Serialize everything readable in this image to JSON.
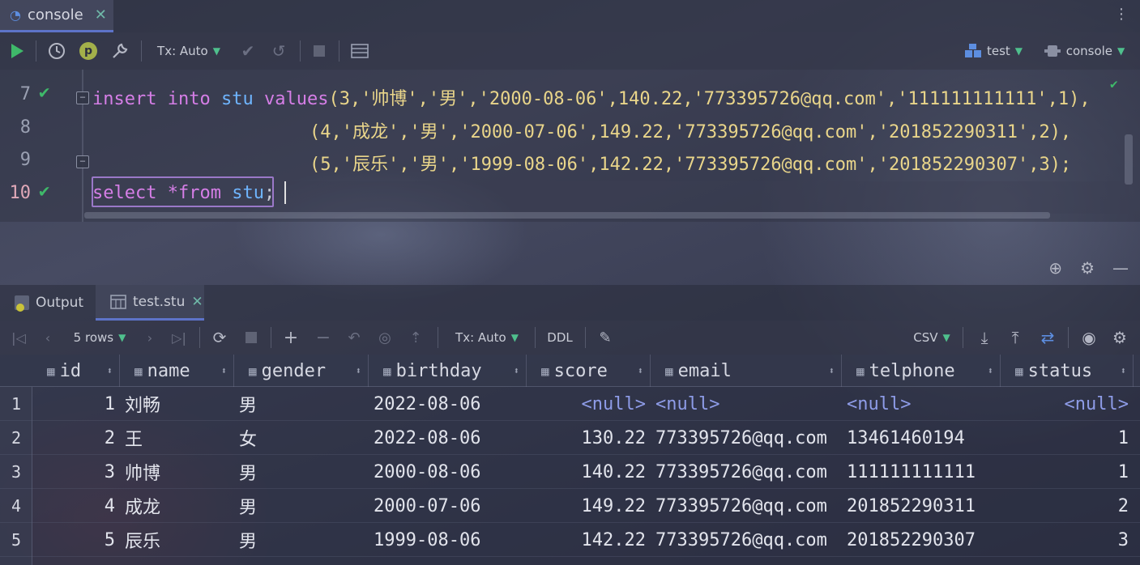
{
  "tab": {
    "label": "console",
    "close": "✕"
  },
  "toolbar": {
    "tx_label": "Tx: Auto",
    "datasource": "test",
    "session": "console",
    "p_badge": "p"
  },
  "editor": {
    "lines": [
      {
        "number": "7",
        "status": "ok",
        "active": false
      },
      {
        "number": "8",
        "status": "",
        "active": false
      },
      {
        "number": "9",
        "status": "",
        "active": false
      },
      {
        "number": "10",
        "status": "ok",
        "active": true
      }
    ],
    "code": {
      "line7": {
        "kw1": "insert",
        "kw2": "into",
        "table": "stu",
        "kw3": "values",
        "tail": "(3,'帅博','男','2000-08-06',140.22,'773395726@qq.com','111111111111',1),"
      },
      "line8": "(4,'成龙','男','2000-07-06',149.22,'773395726@qq.com','201852290311',2),",
      "line9": "(5,'辰乐','男','1999-08-06',142.22,'773395726@qq.com','201852290307',3);",
      "line10": {
        "kw1": "select",
        "star": "*",
        "kw2": "from",
        "table": "stu",
        "end": ";"
      }
    }
  },
  "results": {
    "tabs": [
      {
        "label": "Output"
      },
      {
        "label": "test.stu",
        "close": "✕"
      }
    ],
    "toolbar": {
      "rows_label": "5 rows",
      "tx_label": "Tx: Auto",
      "ddl_label": "DDL",
      "export_label": "CSV"
    },
    "columns": [
      "id",
      "name",
      "gender",
      "birthday",
      "score",
      "email",
      "telphone",
      "status"
    ],
    "null_text": "<null>",
    "rows": [
      {
        "n": "1",
        "id": "1",
        "name": "刘畅",
        "gender": "男",
        "birthday": "2022-08-06",
        "score": null,
        "email": null,
        "telphone": null,
        "status": null
      },
      {
        "n": "2",
        "id": "2",
        "name": "王",
        "gender": "女",
        "birthday": "2022-08-06",
        "score": "130.22",
        "email": "773395726@qq.com",
        "telphone": "13461460194",
        "status": "1"
      },
      {
        "n": "3",
        "id": "3",
        "name": "帅博",
        "gender": "男",
        "birthday": "2000-08-06",
        "score": "140.22",
        "email": "773395726@qq.com",
        "telphone": "111111111111",
        "status": "1"
      },
      {
        "n": "4",
        "id": "4",
        "name": "成龙",
        "gender": "男",
        "birthday": "2000-07-06",
        "score": "149.22",
        "email": "773395726@qq.com",
        "telphone": "201852290311",
        "status": "2"
      },
      {
        "n": "5",
        "id": "5",
        "name": "辰乐",
        "gender": "男",
        "birthday": "1999-08-06",
        "score": "142.22",
        "email": "773395726@qq.com",
        "telphone": "201852290307",
        "status": "3"
      }
    ]
  },
  "colors": {
    "keyword": "#d57ee6",
    "table": "#6fb5ff",
    "string": "#e9d58a",
    "ok": "#3fb96a",
    "null": "#8e9ce8"
  }
}
